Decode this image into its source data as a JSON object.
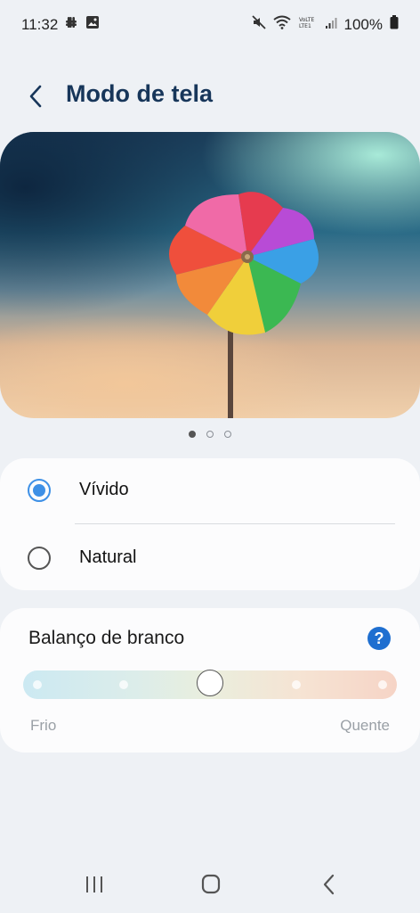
{
  "status_bar": {
    "time": "11:32",
    "left_icons": [
      "slack-icon",
      "gallery-icon"
    ],
    "right_icons": [
      "mute-icon",
      "wifi-icon",
      "volte-lte-icon",
      "signal-icon"
    ],
    "battery": "100%"
  },
  "header": {
    "title": "Modo de tela",
    "back_icon": "chevron-left-icon"
  },
  "preview": {
    "pages": 3,
    "current_page": 1
  },
  "screen_modes": {
    "options": [
      {
        "label": "Vívido",
        "selected": true
      },
      {
        "label": "Natural",
        "selected": false
      }
    ]
  },
  "white_balance": {
    "title": "Balanço de branco",
    "help_icon": "help-icon",
    "help_symbol": "?",
    "left_label": "Frio",
    "right_label": "Quente",
    "steps": 5,
    "value_index": 2
  },
  "nav_bar": {
    "buttons": [
      "recents-icon",
      "home-icon",
      "back-icon"
    ]
  },
  "colors": {
    "accent": "#3e90e6",
    "title": "#17365a",
    "help": "#1f6fd0"
  }
}
